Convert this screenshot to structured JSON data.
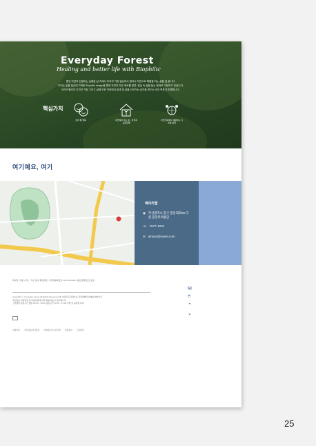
{
  "hero": {
    "title": "Everyday Forest",
    "subtitle": "Healing and better life with Biophilic",
    "lines": [
      "원인 자연과 단절되는 상황한 삶 속에서 우리의 가장 일상에서 발이나 자연으로 해행을 하는 삶을 꿈 꿉니다.",
      "우리는 삶을 일상에 가까운 Biophilic design을 통해 자연의 치유 위로를 발견, 일상 속 삶을 돕는 형태로 구현하고 있습니다.",
      "바이오필리아 디자인 가정 그리고 삶에 모든 자연에서 효과 및 삶을 쉬어가는 공간을 만드는 것이 목표이 만큼합니다."
    ],
    "core_label": "핵심가치",
    "values": [
      {
        "icon": "smile-faces-icon",
        "caption": "삶의 웰 행복"
      },
      {
        "icon": "house-plant-icon",
        "caption": "자연에서 주는 쉼 · 환경과 공존함께"
      },
      {
        "icon": "people-globe-icon",
        "caption": "자연친화에서 생활하는 기치를 실현"
      }
    ]
  },
  "section": {
    "title": "여기예요, 여기"
  },
  "contact": {
    "heading": "에이리엠",
    "address": "부산광역시 중구 중앙대로26 다원 중앙타워빌딩",
    "phone": "1577-1234",
    "email": "aimum@naver.com"
  },
  "footer": {
    "company": "회사명 | 대표 | 주소 : 부산 중구 중앙대로 | 사업자등록번호 000-00-00000 | 통신판매업신고번호",
    "policy_lines": [
      "Copyright ⓒ Everyday Forest All Rights Reserved. 본 사이트의 콘텐츠는 저작권법의 보호를 받습니다.",
      "개인정보 처리방침 및 이용약관에 따라 회원 정보가 관리됩니다.",
      "고객센터 운영시간 평일 09:00 - 18:00 점심시간 12:00 - 13:00 주말 및 공휴일 휴무"
    ],
    "links": [
      "이용약관",
      "개인정보처리방침",
      "이메일무단수집거부",
      "제휴문의",
      "고객센터"
    ]
  },
  "page_number": "25",
  "colors": {
    "hero": "#3f5f33",
    "info": "#4a6a87",
    "accent": "#8aa9d6",
    "title": "#2c4a7c"
  }
}
